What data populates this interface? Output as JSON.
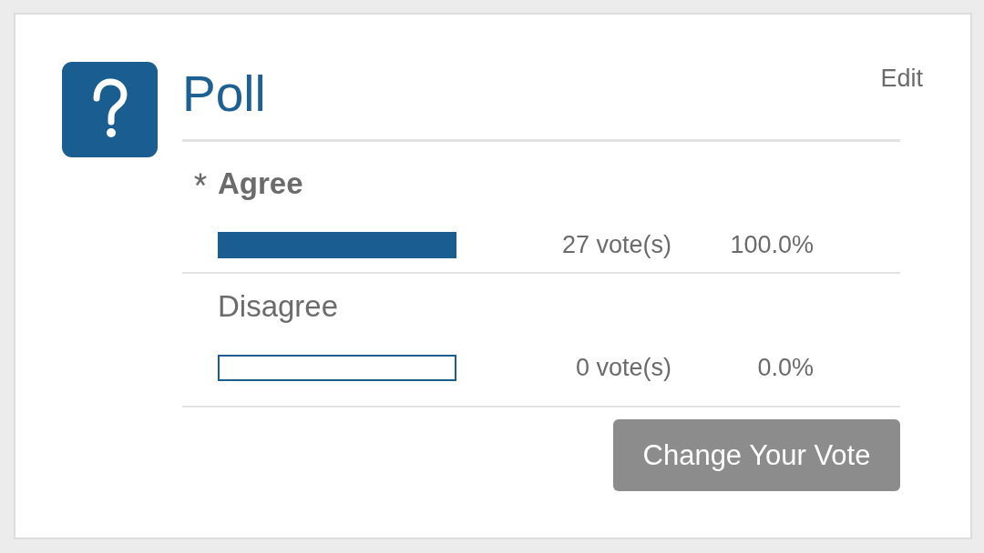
{
  "poll": {
    "title": "Poll",
    "edit_link": "Edit",
    "options": [
      {
        "label": "Agree",
        "selected": true,
        "level": 1.0,
        "votes": "27 vote(s)",
        "percent": "100.0%"
      },
      {
        "label": "Disagree",
        "selected": false,
        "level": 0,
        "votes": "0 vote(s)",
        "percent": "0.0%"
      }
    ],
    "button": "Change Your Vote"
  }
}
